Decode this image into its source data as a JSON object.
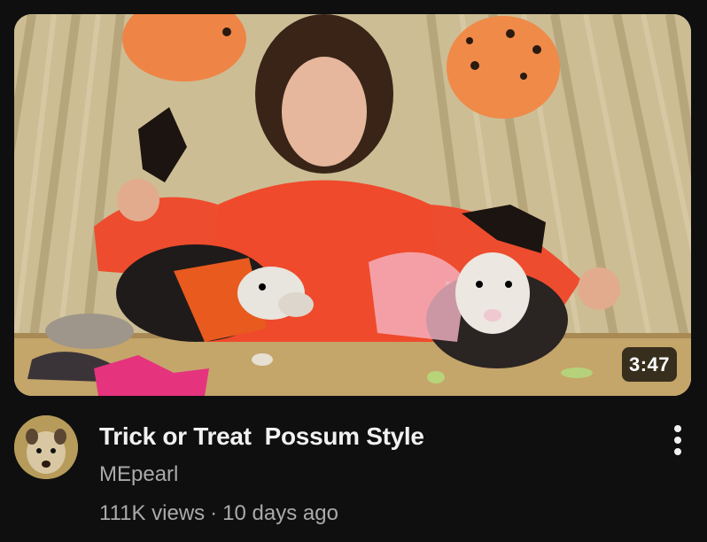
{
  "video": {
    "duration": "3:47",
    "title": "Trick or Treat  Possum Style",
    "channel": "MEpearl",
    "views": "111K views",
    "separator": "·",
    "age": "10 days ago"
  },
  "icons": {
    "more": "more-vertical-icon"
  },
  "colors": {
    "background": "#0f0f0f",
    "title": "#f1f1f1",
    "secondary": "#aaaaaa",
    "duration_bg": "#000000"
  }
}
